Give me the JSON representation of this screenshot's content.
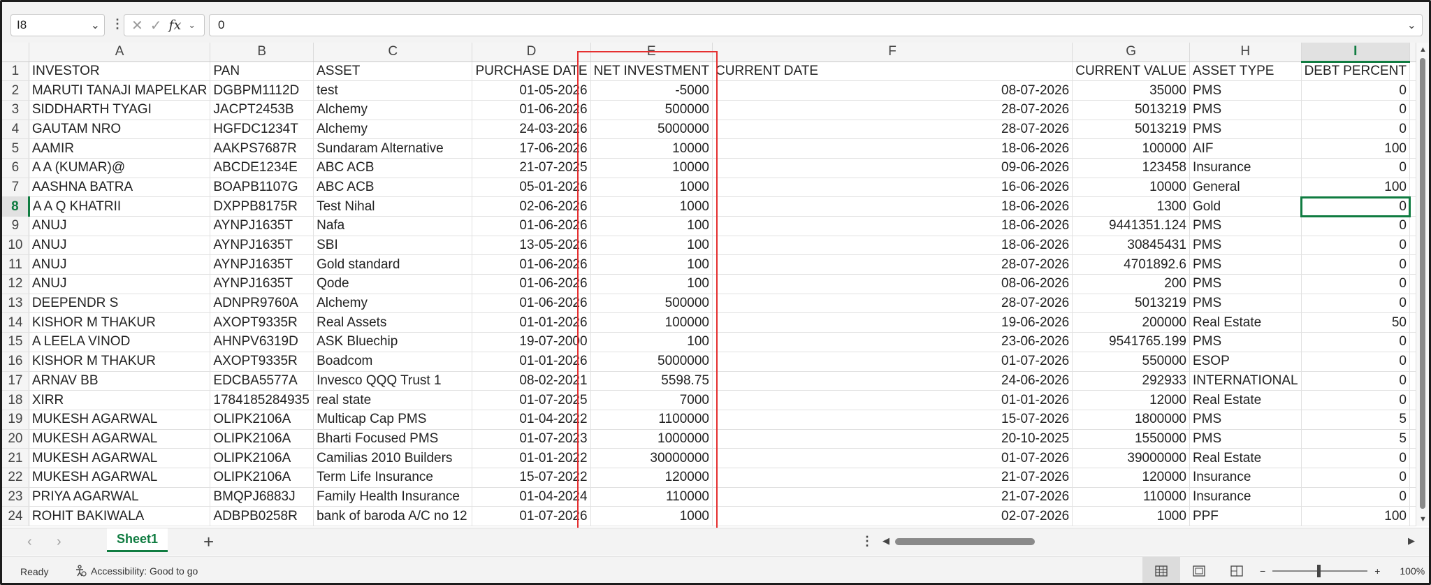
{
  "formula_bar": {
    "name_box": "I8",
    "formula": "0"
  },
  "columns": [
    "A",
    "B",
    "C",
    "D",
    "E",
    "F",
    "G",
    "H",
    "I"
  ],
  "selected_column": "I",
  "header_row": {
    "row_num": "1",
    "cells": [
      "INVESTOR",
      "PAN",
      "ASSET",
      "PURCHASE DATE",
      "NET INVESTMENT",
      "CURRENT DATE",
      "CURRENT VALUE",
      "ASSET TYPE",
      "DEBT PERCENT"
    ]
  },
  "rows": [
    {
      "n": "2",
      "c": [
        "MARUTI TANAJI MAPELKAR",
        "DGBPM1112D",
        "test",
        "01-05-2026",
        "-5000",
        "08-07-2026",
        "35000",
        "PMS",
        "0"
      ]
    },
    {
      "n": "3",
      "c": [
        "SIDDHARTH TYAGI",
        "JACPT2453B",
        "Alchemy",
        "01-06-2026",
        "500000",
        "28-07-2026",
        "5013219",
        "PMS",
        "0"
      ]
    },
    {
      "n": "4",
      "c": [
        "GAUTAM NRO",
        "HGFDC1234T",
        "Alchemy",
        "24-03-2026",
        "5000000",
        "28-07-2026",
        "5013219",
        "PMS",
        "0"
      ]
    },
    {
      "n": "5",
      "c": [
        "AAMIR",
        "AAKPS7687R",
        "Sundaram Alternative",
        "17-06-2026",
        "10000",
        "18-06-2026",
        "100000",
        "AIF",
        "100"
      ]
    },
    {
      "n": "6",
      "c": [
        "A A (KUMAR)@",
        "ABCDE1234E",
        "ABC ACB",
        "21-07-2025",
        "10000",
        "09-06-2026",
        "123458",
        "Insurance",
        "0"
      ]
    },
    {
      "n": "7",
      "c": [
        "AASHNA BATRA",
        "BOAPB1107G",
        "ABC ACB",
        "05-01-2026",
        "1000",
        "16-06-2026",
        "10000",
        "General",
        "100"
      ]
    },
    {
      "n": "8",
      "c": [
        "A A Q KHATRII",
        "DXPPB8175R",
        "Test Nihal",
        "02-06-2026",
        "1000",
        "18-06-2026",
        "1300",
        "Gold",
        "0"
      ]
    },
    {
      "n": "9",
      "c": [
        "ANUJ",
        "AYNPJ1635T",
        "Nafa",
        "01-06-2026",
        "100",
        "18-06-2026",
        "9441351.124",
        "PMS",
        "0"
      ]
    },
    {
      "n": "10",
      "c": [
        "ANUJ",
        "AYNPJ1635T",
        "SBI",
        "13-05-2026",
        "100",
        "18-06-2026",
        "30845431",
        "PMS",
        "0"
      ]
    },
    {
      "n": "11",
      "c": [
        "ANUJ",
        "AYNPJ1635T",
        "Gold standard",
        "01-06-2026",
        "100",
        "28-07-2026",
        "4701892.6",
        "PMS",
        "0"
      ]
    },
    {
      "n": "12",
      "c": [
        "ANUJ",
        "AYNPJ1635T",
        "Qode",
        "01-06-2026",
        "100",
        "08-06-2026",
        "200",
        "PMS",
        "0"
      ]
    },
    {
      "n": "13",
      "c": [
        "DEEPENDR S",
        "ADNPR9760A",
        "Alchemy",
        "01-06-2026",
        "500000",
        "28-07-2026",
        "5013219",
        "PMS",
        "0"
      ]
    },
    {
      "n": "14",
      "c": [
        "KISHOR M THAKUR",
        "AXOPT9335R",
        "Real Assets",
        "01-01-2026",
        "100000",
        "19-06-2026",
        "200000",
        "Real Estate",
        "50"
      ]
    },
    {
      "n": "15",
      "c": [
        "A LEELA VINOD",
        "AHNPV6319D",
        "ASK Bluechip",
        "19-07-2000",
        "100",
        "23-06-2026",
        "9541765.199",
        "PMS",
        "0"
      ]
    },
    {
      "n": "16",
      "c": [
        "KISHOR M THAKUR",
        "AXOPT9335R",
        "Boadcom",
        "01-01-2026",
        "5000000",
        "01-07-2026",
        "550000",
        "ESOP",
        "0"
      ]
    },
    {
      "n": "17",
      "c": [
        "ARNAV BB",
        "EDCBA5577A",
        "Invesco QQQ Trust 1",
        "08-02-2021",
        "5598.75",
        "24-06-2026",
        "292933",
        "INTERNATIONAL",
        "0"
      ]
    },
    {
      "n": "18",
      "c": [
        "XIRR",
        "1784185284935",
        "real state",
        "01-07-2025",
        "7000",
        "01-01-2026",
        "12000",
        "Real Estate",
        "0"
      ]
    },
    {
      "n": "19",
      "c": [
        "MUKESH AGARWAL",
        "OLIPK2106A",
        "Multicap Cap PMS",
        "01-04-2022",
        "1100000",
        "15-07-2026",
        "1800000",
        "PMS",
        "5"
      ]
    },
    {
      "n": "20",
      "c": [
        "MUKESH AGARWAL",
        "OLIPK2106A",
        "Bharti Focused PMS",
        "01-07-2023",
        "1000000",
        "20-10-2025",
        "1550000",
        "PMS",
        "5"
      ]
    },
    {
      "n": "21",
      "c": [
        "MUKESH AGARWAL",
        "OLIPK2106A",
        "Camilias 2010 Builders",
        "01-01-2022",
        "30000000",
        "01-07-2026",
        "39000000",
        "Real Estate",
        "0"
      ]
    },
    {
      "n": "22",
      "c": [
        "MUKESH AGARWAL",
        "OLIPK2106A",
        "Term Life Insurance",
        "15-07-2022",
        "120000",
        "21-07-2026",
        "120000",
        "Insurance",
        "0"
      ]
    },
    {
      "n": "23",
      "c": [
        "PRIYA AGARWAL",
        "BMQPJ6883J",
        "Family Health Insurance",
        "01-04-2024",
        "110000",
        "21-07-2026",
        "110000",
        "Insurance",
        "0"
      ]
    },
    {
      "n": "24",
      "c": [
        "ROHIT BAKIWALA",
        "ADBPB0258R",
        "bank of baroda A/C no 12",
        "01-07-2026",
        "1000",
        "02-07-2026",
        "1000",
        "PPF",
        "100"
      ]
    }
  ],
  "active_cell": {
    "row": "8",
    "col": "I"
  },
  "sheet_tabs": [
    "Sheet1"
  ],
  "status": {
    "ready": "Ready",
    "accessibility": "Accessibility: Good to go",
    "zoom": "100%"
  },
  "colors": {
    "accent": "#107c41",
    "highlight_box": "#e53030"
  }
}
